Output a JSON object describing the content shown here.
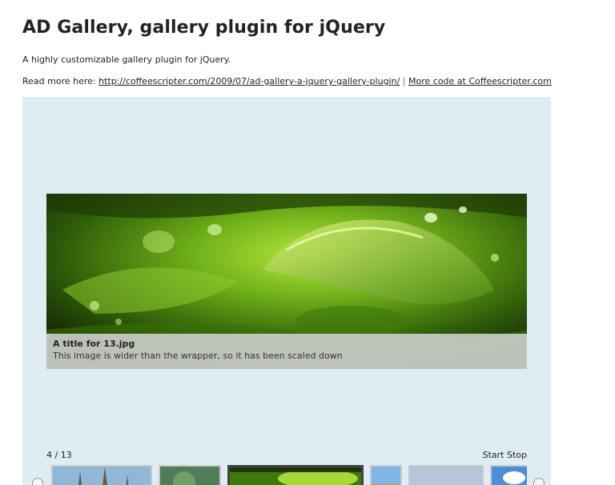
{
  "page": {
    "title": "AD Gallery, gallery plugin for jQuery",
    "description": "A highly customizable gallery plugin for jQuery.",
    "read_more_prefix": "Read more here:",
    "read_more_link": "http://coffeescripter.com/2009/07/ad-gallery-a-jquery-gallery-plugin/",
    "separator": "|",
    "more_code_link": "More code at Coffeescripter.com"
  },
  "gallery": {
    "image_title": "A title for 13.jpg",
    "image_description": "This image is wider than the wrapper, so it has been scaled down",
    "counter_current": "4",
    "counter_sep": "/",
    "counter_total": "13",
    "start_label": "Start",
    "stop_label": "Stop",
    "colors": {
      "background": "#e0ecf3",
      "image_primary": "#6fb01a",
      "image_dark": "#1c3a05"
    }
  }
}
